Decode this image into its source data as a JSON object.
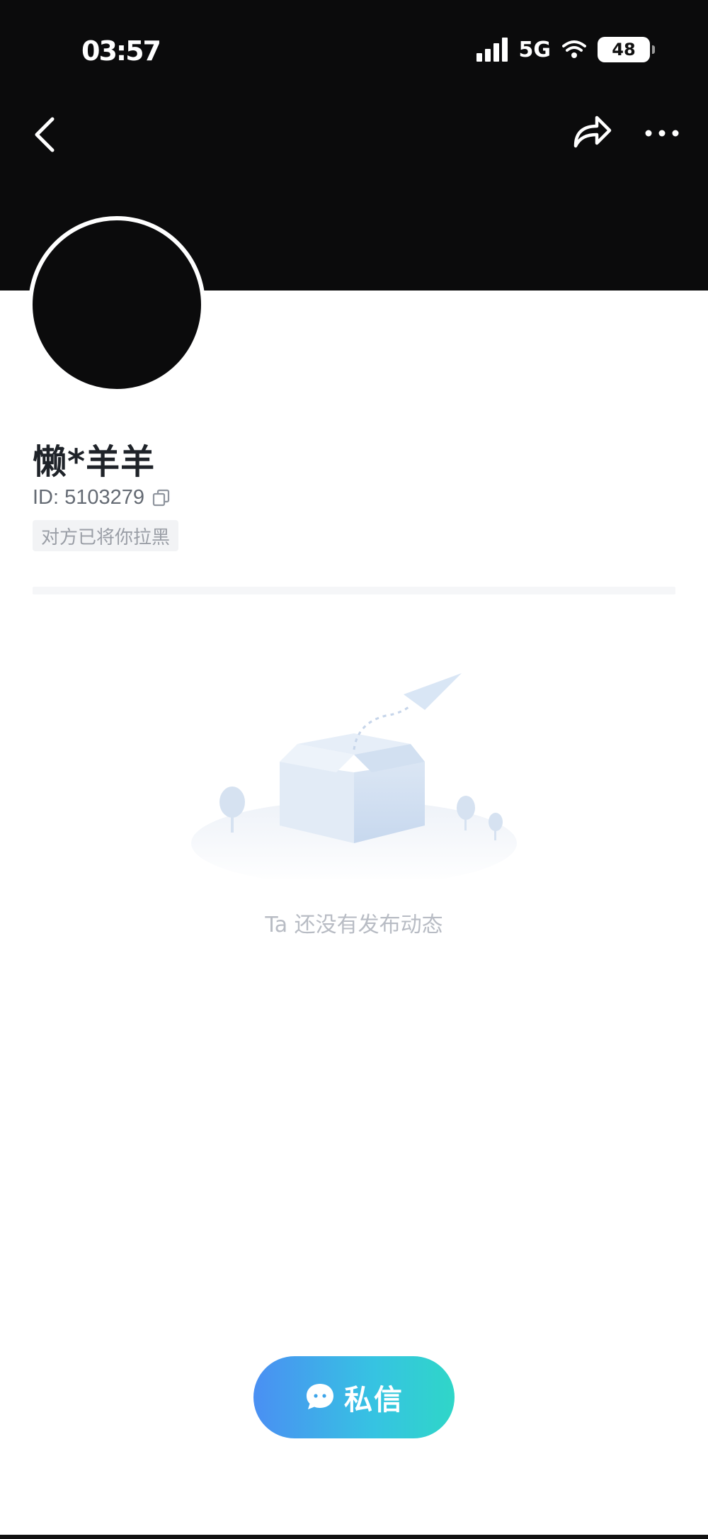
{
  "status_bar": {
    "time": "03:57",
    "network": "5G",
    "battery": "48",
    "signal_icon": "signal-bars-icon",
    "battery_icon": "battery-icon"
  },
  "nav": {
    "back_icon": "chevron-left-icon",
    "share_icon": "share-arrow-icon",
    "more_icon": "more-dots-icon"
  },
  "profile": {
    "nickname": "懒*羊羊",
    "id_text": "ID: 5103279",
    "copy_icon": "copy-icon",
    "blocked_notice": "对方已将你拉黑"
  },
  "feed": {
    "empty_text": "Ta 还没有发布动态",
    "empty_illustration": "empty-box-paper-plane-illustration"
  },
  "actions": {
    "message_label": "私信",
    "message_icon": "chat-bubble-icon",
    "accent_gradient": [
      "#4a8ff3",
      "#2fd6c8"
    ]
  },
  "colors": {
    "header_bg": "#0b0b0c",
    "empty_text": "#b8bcc4",
    "tag_bg": "#f2f3f5"
  }
}
